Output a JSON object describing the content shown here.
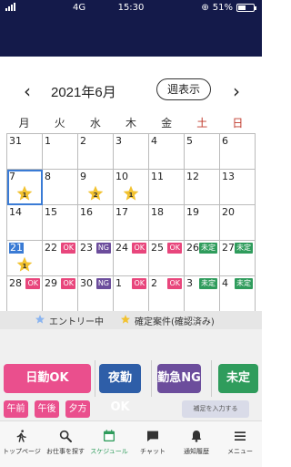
{
  "status": {
    "network": "4G",
    "time": "15:30",
    "battery": "51%",
    "battery_level": 0.51
  },
  "calendar": {
    "title": "2021年6月",
    "week_view_label": "週表示",
    "weekdays": [
      "月",
      "火",
      "水",
      "木",
      "金",
      "土",
      "日"
    ],
    "days": [
      {
        "d": "31"
      },
      {
        "d": "1"
      },
      {
        "d": "2"
      },
      {
        "d": "3"
      },
      {
        "d": "4"
      },
      {
        "d": "5"
      },
      {
        "d": "6"
      },
      {
        "d": "7",
        "selected": true,
        "star": "1"
      },
      {
        "d": "8"
      },
      {
        "d": "9",
        "star": "2"
      },
      {
        "d": "10",
        "star": "1"
      },
      {
        "d": "11"
      },
      {
        "d": "12"
      },
      {
        "d": "13"
      },
      {
        "d": "14"
      },
      {
        "d": "15"
      },
      {
        "d": "16"
      },
      {
        "d": "17"
      },
      {
        "d": "18"
      },
      {
        "d": "19"
      },
      {
        "d": "20"
      },
      {
        "d": "21",
        "today": true,
        "star": "1"
      },
      {
        "d": "22",
        "badge": "OK"
      },
      {
        "d": "23",
        "badge": "NG"
      },
      {
        "d": "24",
        "badge": "OK"
      },
      {
        "d": "25",
        "badge": "OK"
      },
      {
        "d": "26",
        "badge": "未定"
      },
      {
        "d": "27",
        "badge": "未定"
      },
      {
        "d": "28",
        "badge": "OK"
      },
      {
        "d": "29",
        "badge": "OK"
      },
      {
        "d": "30",
        "badge": "NG"
      },
      {
        "d": "1",
        "badge": "OK"
      },
      {
        "d": "2",
        "badge": "OK"
      },
      {
        "d": "3",
        "badge": "未定"
      },
      {
        "d": "4",
        "badge": "未定"
      }
    ]
  },
  "legend": {
    "entry": "エントリー中",
    "confirmed": "確定案件(確認済み)",
    "entry_color": "#8ab4f0",
    "confirmed_color": "#f2c230"
  },
  "actions": {
    "day_ok": "日勤OK",
    "night_ok": "夜勤OK",
    "urgent_ng": "勤急NG",
    "undecided": "未定",
    "morning": "午前",
    "afternoon": "午後",
    "evening": "夕方",
    "note": "補足を入力する"
  },
  "tabs": [
    {
      "label": "トップページ",
      "icon": "walker-icon"
    },
    {
      "label": "お仕事を探す",
      "icon": "search-icon"
    },
    {
      "label": "スケジュール",
      "icon": "calendar-icon",
      "active": true
    },
    {
      "label": "チャット",
      "icon": "chat-icon"
    },
    {
      "label": "通知履歴",
      "icon": "bell-icon"
    },
    {
      "label": "メニュー",
      "icon": "menu-icon"
    }
  ],
  "colors": {
    "header": "#141a4a",
    "ok": "#e8467c",
    "ng": "#6c4d9c",
    "undecided": "#2f9c5c",
    "night": "#2e5ea8"
  }
}
